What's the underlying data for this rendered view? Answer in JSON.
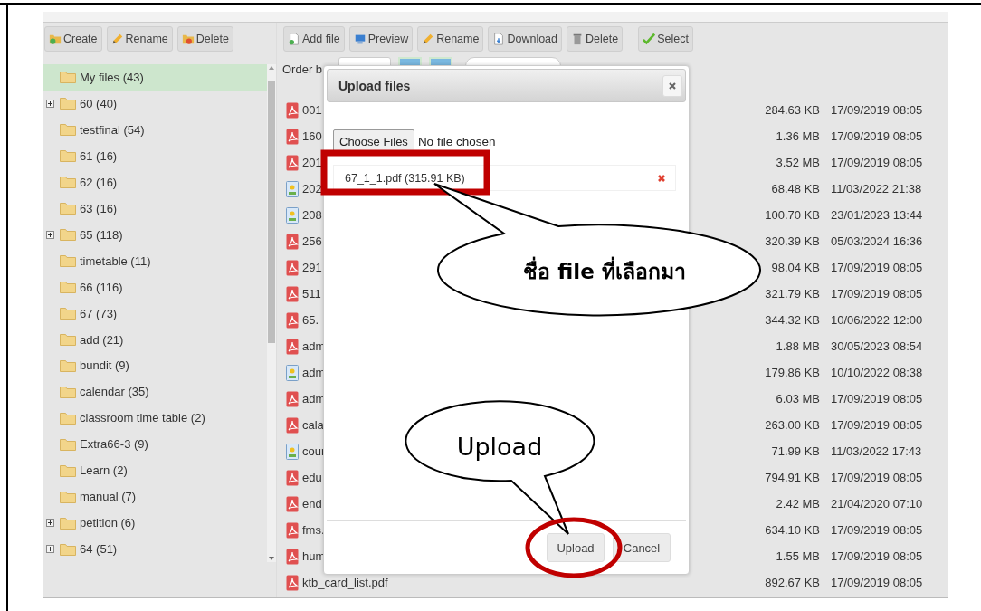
{
  "left_toolbar": [
    "Create",
    "Rename",
    "Delete"
  ],
  "folders": [
    {
      "label": "My files (43)",
      "selected": true,
      "has_children": false
    },
    {
      "label": "60 (40)",
      "selected": false,
      "has_children": true
    },
    {
      "label": "testfinal (54)",
      "selected": false,
      "has_children": false
    },
    {
      "label": "61 (16)",
      "selected": false,
      "has_children": false
    },
    {
      "label": "62 (16)",
      "selected": false,
      "has_children": false
    },
    {
      "label": "63 (16)",
      "selected": false,
      "has_children": false
    },
    {
      "label": "65 (118)",
      "selected": false,
      "has_children": true
    },
    {
      "label": "timetable (11)",
      "selected": false,
      "has_children": false
    },
    {
      "label": "66 (116)",
      "selected": false,
      "has_children": false
    },
    {
      "label": "67 (73)",
      "selected": false,
      "has_children": false
    },
    {
      "label": "add (21)",
      "selected": false,
      "has_children": false
    },
    {
      "label": "bundit (9)",
      "selected": false,
      "has_children": false
    },
    {
      "label": "calendar (35)",
      "selected": false,
      "has_children": false
    },
    {
      "label": "classroom time table (2)",
      "selected": false,
      "has_children": false
    },
    {
      "label": "Extra66-3 (9)",
      "selected": false,
      "has_children": false
    },
    {
      "label": "Learn (2)",
      "selected": false,
      "has_children": false
    },
    {
      "label": "manual (7)",
      "selected": false,
      "has_children": false
    },
    {
      "label": "petition (6)",
      "selected": false,
      "has_children": true
    },
    {
      "label": "64 (51)",
      "selected": false,
      "has_children": true
    }
  ],
  "right_toolbar": [
    "Add file",
    "Preview",
    "Rename",
    "Download",
    "Delete",
    "Select"
  ],
  "order_label": "Order b",
  "files": [
    {
      "name": "001",
      "kind": "pdf",
      "size": "284.63 KB",
      "modified": "17/09/2019 08:05"
    },
    {
      "name": "160",
      "kind": "pdf",
      "size": "1.36 MB",
      "modified": "17/09/2019 08:05"
    },
    {
      "name": "201",
      "kind": "pdf",
      "size": "3.52 MB",
      "modified": "17/09/2019 08:05"
    },
    {
      "name": "202",
      "kind": "image",
      "size": "68.48 KB",
      "modified": "11/03/2022 21:38"
    },
    {
      "name": "208",
      "kind": "image",
      "size": "100.70 KB",
      "modified": "23/01/2023 13:44"
    },
    {
      "name": "256",
      "kind": "pdf",
      "size": "320.39 KB",
      "modified": "05/03/2024 16:36"
    },
    {
      "name": "291",
      "kind": "pdf",
      "size": "98.04 KB",
      "modified": "17/09/2019 08:05"
    },
    {
      "name": "511",
      "kind": "pdf",
      "size": "321.79 KB",
      "modified": "17/09/2019 08:05"
    },
    {
      "name": "65.",
      "kind": "pdf",
      "size": "344.32 KB",
      "modified": "10/06/2022 12:00"
    },
    {
      "name": "adm",
      "kind": "pdf",
      "size": "1.88 MB",
      "modified": "30/05/2023 08:54"
    },
    {
      "name": "adm",
      "kind": "image",
      "size": "179.86 KB",
      "modified": "10/10/2022 08:38"
    },
    {
      "name": "adm",
      "kind": "pdf",
      "size": "6.03 MB",
      "modified": "17/09/2019 08:05"
    },
    {
      "name": "cala",
      "kind": "pdf",
      "size": "263.00 KB",
      "modified": "17/09/2019 08:05"
    },
    {
      "name": "cour",
      "kind": "image",
      "size": "71.99 KB",
      "modified": "11/03/2022 17:43"
    },
    {
      "name": "edu",
      "kind": "pdf",
      "size": "794.91 KB",
      "modified": "17/09/2019 08:05"
    },
    {
      "name": "end",
      "kind": "pdf",
      "size": "2.42 MB",
      "modified": "21/04/2020 07:10"
    },
    {
      "name": "fms.",
      "kind": "pdf",
      "size": "634.10 KB",
      "modified": "17/09/2019 08:05"
    },
    {
      "name": "hum",
      "kind": "pdf",
      "size": "1.55 MB",
      "modified": "17/09/2019 08:05"
    },
    {
      "name": "ktb_card_list.pdf",
      "kind": "pdf",
      "size": "892.67 KB",
      "modified": "17/09/2019 08:05"
    }
  ],
  "dialog": {
    "title": "Upload files",
    "choose_button": "Choose Files",
    "file_status": "No file chosen",
    "queued_files": [
      "67_1_1.pdf (315.91 KB)"
    ],
    "buttons": [
      "Upload",
      "Cancel"
    ]
  },
  "annotations": {
    "file_callout": "ชื่อ file ที่เลือกมา",
    "upload_callout": "Upload"
  }
}
